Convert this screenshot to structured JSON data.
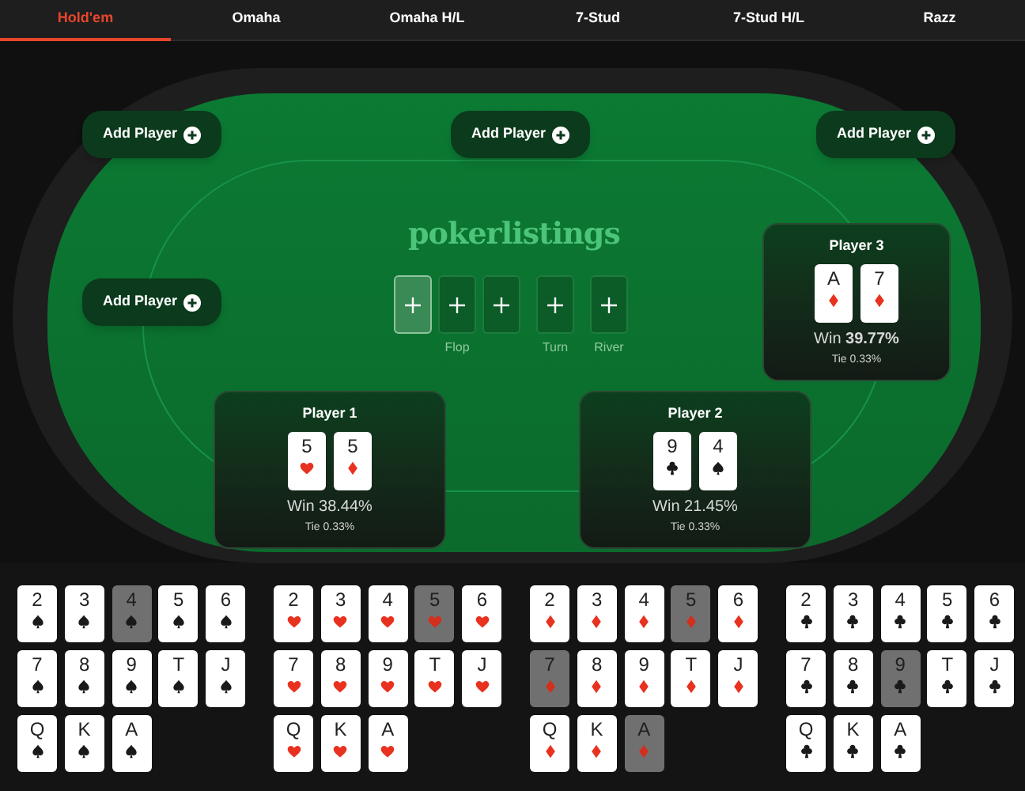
{
  "tabs": [
    {
      "label": "Hold'em",
      "selected": true
    },
    {
      "label": "Omaha",
      "selected": false
    },
    {
      "label": "Omaha H/L",
      "selected": false
    },
    {
      "label": "7-Stud",
      "selected": false
    },
    {
      "label": "7-Stud H/L",
      "selected": false
    },
    {
      "label": "Razz",
      "selected": false
    }
  ],
  "table": {
    "logo": "pokerlistings",
    "seats": [
      {
        "kind": "add",
        "label": "Add Player"
      },
      {
        "kind": "add",
        "label": "Add Player"
      },
      {
        "kind": "add",
        "label": "Add Player"
      },
      {
        "kind": "add",
        "label": "Add Player"
      },
      {
        "kind": "player",
        "name": "Player 3",
        "cards": [
          {
            "rank": "A",
            "kind": "diamonds"
          },
          {
            "rank": "7",
            "kind": "diamonds"
          }
        ],
        "win": "Win **39.77%**",
        "tie": "Tie 0.33%"
      },
      {
        "kind": "player",
        "name": "Player 1",
        "cards": [
          {
            "rank": "5",
            "kind": "hearts"
          },
          {
            "rank": "5",
            "kind": "diamonds"
          }
        ],
        "win": "Win 38.44%",
        "tie": "Tie 0.33%"
      },
      {
        "kind": "player",
        "name": "Player 2",
        "cards": [
          {
            "rank": "9",
            "kind": "clubs"
          },
          {
            "rank": "4",
            "kind": "spades"
          }
        ],
        "win": "Win 21.45%",
        "tie": "Tie 0.33%"
      }
    ],
    "board": [
      {
        "group": "Flop",
        "slots": [
          {
            "selected": true
          },
          {
            "selected": false
          },
          {
            "selected": false
          }
        ]
      },
      {
        "group": "Turn",
        "slots": [
          {
            "selected": false
          }
        ]
      },
      {
        "group": "River",
        "slots": [
          {
            "selected": false
          }
        ]
      }
    ]
  },
  "deck": [
    {
      "kind": "spades",
      "cards": [
        {
          "rank": "2",
          "used": false
        },
        {
          "rank": "3",
          "used": false
        },
        {
          "rank": "4",
          "used": true
        },
        {
          "rank": "5",
          "used": false
        },
        {
          "rank": "6",
          "used": false
        },
        {
          "rank": "7",
          "used": false
        },
        {
          "rank": "8",
          "used": false
        },
        {
          "rank": "9",
          "used": false
        },
        {
          "rank": "T",
          "used": false
        },
        {
          "rank": "J",
          "used": false
        },
        {
          "rank": "Q",
          "used": false
        },
        {
          "rank": "K",
          "used": false
        },
        {
          "rank": "A",
          "used": false
        }
      ]
    },
    {
      "kind": "hearts",
      "cards": [
        {
          "rank": "2",
          "used": false
        },
        {
          "rank": "3",
          "used": false
        },
        {
          "rank": "4",
          "used": false
        },
        {
          "rank": "5",
          "used": true
        },
        {
          "rank": "6",
          "used": false
        },
        {
          "rank": "7",
          "used": false
        },
        {
          "rank": "8",
          "used": false
        },
        {
          "rank": "9",
          "used": false
        },
        {
          "rank": "T",
          "used": false
        },
        {
          "rank": "J",
          "used": false
        },
        {
          "rank": "Q",
          "used": false
        },
        {
          "rank": "K",
          "used": false
        },
        {
          "rank": "A",
          "used": false
        }
      ]
    },
    {
      "kind": "diamonds",
      "cards": [
        {
          "rank": "2",
          "used": false
        },
        {
          "rank": "3",
          "used": false
        },
        {
          "rank": "4",
          "used": false
        },
        {
          "rank": "5",
          "used": true
        },
        {
          "rank": "6",
          "used": false
        },
        {
          "rank": "7",
          "used": true
        },
        {
          "rank": "8",
          "used": false
        },
        {
          "rank": "9",
          "used": false
        },
        {
          "rank": "T",
          "used": false
        },
        {
          "rank": "J",
          "used": false
        },
        {
          "rank": "Q",
          "used": false
        },
        {
          "rank": "K",
          "used": false
        },
        {
          "rank": "A",
          "used": true
        }
      ]
    },
    {
      "kind": "clubs",
      "cards": [
        {
          "rank": "2",
          "used": false
        },
        {
          "rank": "3",
          "used": false
        },
        {
          "rank": "4",
          "used": false
        },
        {
          "rank": "5",
          "used": false
        },
        {
          "rank": "6",
          "used": false
        },
        {
          "rank": "7",
          "used": false
        },
        {
          "rank": "8",
          "used": false
        },
        {
          "rank": "9",
          "used": true
        },
        {
          "rank": "T",
          "used": false
        },
        {
          "rank": "J",
          "used": false
        },
        {
          "rank": "Q",
          "used": false
        },
        {
          "rank": "K",
          "used": false
        },
        {
          "rank": "A",
          "used": false
        }
      ]
    }
  ]
}
